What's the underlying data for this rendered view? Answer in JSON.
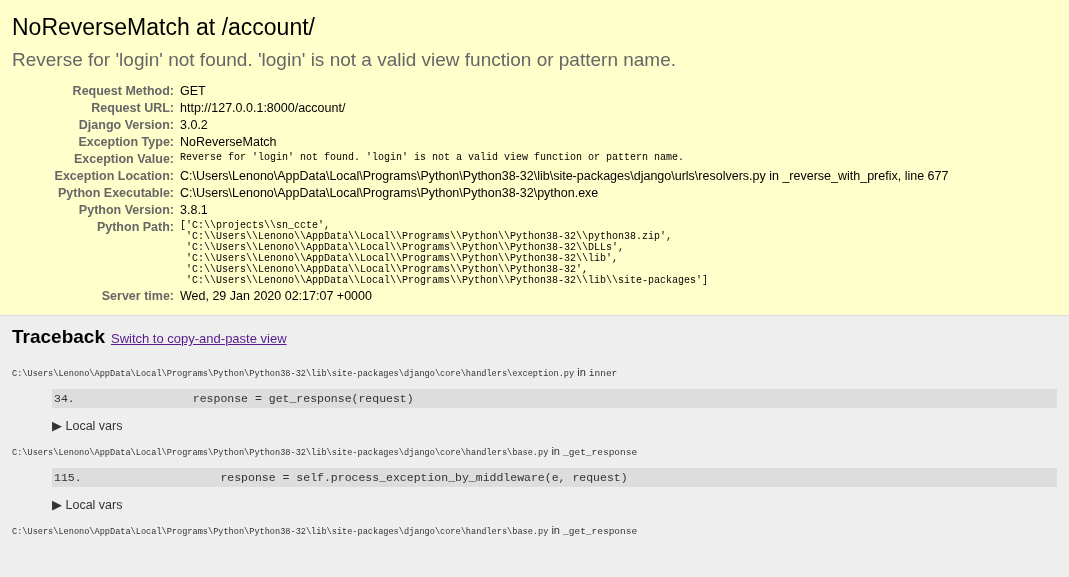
{
  "summary": {
    "title": "NoReverseMatch at /account/",
    "message": "Reverse for 'login' not found. 'login' is not a valid view function or pattern name.",
    "meta": [
      {
        "label": "Request Method:",
        "value": "GET",
        "kind": "text"
      },
      {
        "label": "Request URL:",
        "value": "http://127.0.0.1:8000/account/",
        "kind": "text"
      },
      {
        "label": "Django Version:",
        "value": "3.0.2",
        "kind": "text"
      },
      {
        "label": "Exception Type:",
        "value": "NoReverseMatch",
        "kind": "text"
      },
      {
        "label": "Exception Value:",
        "value": "Reverse for 'login' not found. 'login' is not a valid view function or pattern name.",
        "kind": "code"
      },
      {
        "label": "Exception Location:",
        "value": "C:\\Users\\Lenono\\AppData\\Local\\Programs\\Python\\Python38-32\\lib\\site-packages\\django\\urls\\resolvers.py in _reverse_with_prefix, line 677",
        "kind": "text"
      },
      {
        "label": "Python Executable:",
        "value": "C:\\Users\\Lenono\\AppData\\Local\\Programs\\Python\\Python38-32\\python.exe",
        "kind": "text"
      },
      {
        "label": "Python Version:",
        "value": "3.8.1",
        "kind": "text"
      },
      {
        "label": "Python Path:",
        "value": "['C:\\\\projects\\\\sn_ccte',\n 'C:\\\\Users\\\\Lenono\\\\AppData\\\\Local\\\\Programs\\\\Python\\\\Python38-32\\\\python38.zip',\n 'C:\\\\Users\\\\Lenono\\\\AppData\\\\Local\\\\Programs\\\\Python\\\\Python38-32\\\\DLLs',\n 'C:\\\\Users\\\\Lenono\\\\AppData\\\\Local\\\\Programs\\\\Python\\\\Python38-32\\\\lib',\n 'C:\\\\Users\\\\Lenono\\\\AppData\\\\Local\\\\Programs\\\\Python\\\\Python38-32',\n 'C:\\\\Users\\\\Lenono\\\\AppData\\\\Local\\\\Programs\\\\Python\\\\Python38-32\\\\lib\\\\site-packages']",
        "kind": "code"
      },
      {
        "label": "Server time:",
        "value": "Wed, 29 Jan 2020 02:17:07 +0000",
        "kind": "text"
      }
    ]
  },
  "traceback": {
    "title": "Traceback",
    "link": "Switch to copy-and-paste view",
    "frames": [
      {
        "file": "C:\\Users\\Lenono\\AppData\\Local\\Programs\\Python\\Python38-32\\lib\\site-packages\\django\\core\\handlers\\exception.py",
        "in": "in",
        "function": "inner",
        "line_number": "34.",
        "code": "            response = get_response(request)",
        "vars": "▶ Local vars"
      },
      {
        "file": "C:\\Users\\Lenono\\AppData\\Local\\Programs\\Python\\Python38-32\\lib\\site-packages\\django\\core\\handlers\\base.py",
        "in": "in",
        "function": "_get_response",
        "line_number": "115.",
        "code": "                response = self.process_exception_by_middleware(e, request)",
        "vars": "▶ Local vars"
      },
      {
        "file": "C:\\Users\\Lenono\\AppData\\Local\\Programs\\Python\\Python38-32\\lib\\site-packages\\django\\core\\handlers\\base.py",
        "in": "in",
        "function": "_get_response"
      }
    ]
  }
}
